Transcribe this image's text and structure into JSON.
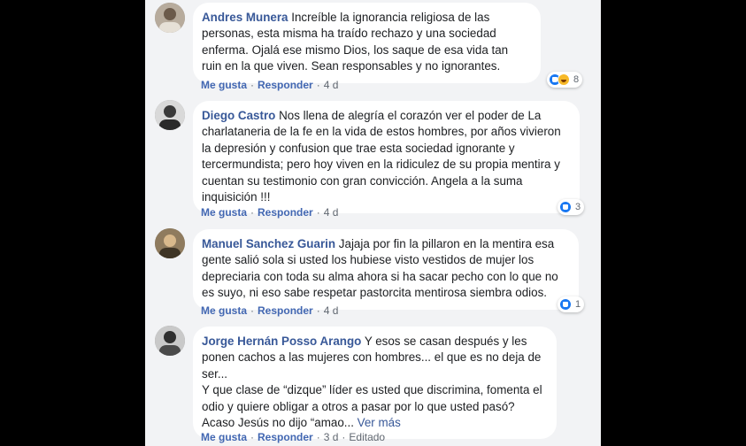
{
  "comments": [
    {
      "author": "Andres Munera",
      "text": "Increíble la ignorancia religiosa de las personas, esta misma ha traído rechazo y una sociedad enferma. Ojalá ese mismo Dios, los saque de esa vida tan ruin en la que viven. Sean responsables y no ignorantes.",
      "like_label": "Me gusta",
      "reply_label": "Responder",
      "time": "4 d",
      "reaction_count": "8",
      "reactions": [
        "like-icon",
        "haha-icon"
      ]
    },
    {
      "author": "Diego Castro",
      "text": "Nos llena de alegría el corazón ver el poder de La charlataneria de la fe en la vida de estos hombres, por años vivieron la depresión y confusion que trae esta sociedad ignorante y tercermundista; pero hoy viven en la ridiculez de su propia mentira y cuentan su testimonio con gran convicción. Angela a la suma inquisición !!!",
      "like_label": "Me gusta",
      "reply_label": "Responder",
      "time": "4 d",
      "reaction_count": "3",
      "reactions": [
        "like-icon"
      ]
    },
    {
      "author": "Manuel Sanchez Guarin",
      "text": "Jajaja por fin la pillaron en la mentira esa gente salió sola si usted los hubiese visto vestidos de mujer los depreciaria con toda su alma ahora si ha sacar pecho con lo que no es suyo, ni eso sabe respetar pastorcita mentirosa siembra odios.",
      "like_label": "Me gusta",
      "reply_label": "Responder",
      "time": "4 d",
      "reaction_count": "1",
      "reactions": [
        "like-icon"
      ]
    },
    {
      "author": "Jorge Hernán Posso Arango",
      "text_line1": "Y esos se casan después y les ponen cachos a las mujeres con hombres... el que es no deja de ser...",
      "text_line2": "Y que clase de “dizque” líder es usted que discrimina, fomenta el odio y quiere obligar a otros a pasar por lo que usted pasó? Acaso Jesús no dijo “amao...",
      "see_more": "Ver más",
      "like_label": "Me gusta",
      "reply_label": "Responder",
      "time": "3 d",
      "edited": "Editado"
    }
  ]
}
